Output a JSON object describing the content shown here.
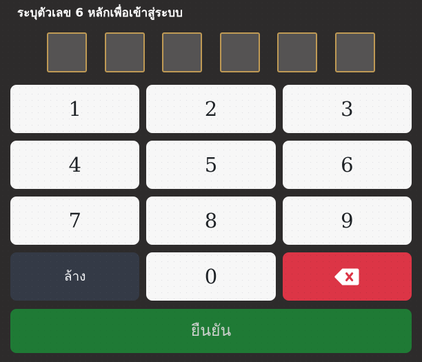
{
  "header": {
    "title": "ระบุตัวเลข 6 หลักเพื่อเข้าสู่ระบบ"
  },
  "pin": {
    "length": 6,
    "boxes": [
      "",
      "",
      "",
      "",
      "",
      ""
    ],
    "border_color": "#bf9a55",
    "fill_color": "#555353"
  },
  "keypad": {
    "keys": [
      {
        "label": "1",
        "type": "digit",
        "name": "key-1"
      },
      {
        "label": "2",
        "type": "digit",
        "name": "key-2"
      },
      {
        "label": "3",
        "type": "digit",
        "name": "key-3"
      },
      {
        "label": "4",
        "type": "digit",
        "name": "key-4"
      },
      {
        "label": "5",
        "type": "digit",
        "name": "key-5"
      },
      {
        "label": "6",
        "type": "digit",
        "name": "key-6"
      },
      {
        "label": "7",
        "type": "digit",
        "name": "key-7"
      },
      {
        "label": "8",
        "type": "digit",
        "name": "key-8"
      },
      {
        "label": "9",
        "type": "digit",
        "name": "key-9"
      },
      {
        "label": "ล้าง",
        "type": "clear",
        "name": "key-clear"
      },
      {
        "label": "0",
        "type": "digit",
        "name": "key-0"
      },
      {
        "label": "",
        "type": "backspace",
        "name": "key-backspace",
        "icon": "backspace-icon"
      }
    ],
    "clear_label": "ล้าง",
    "clear_color": "#343a46",
    "backspace_color": "#dc3546",
    "digit_color": "#f7f7f7"
  },
  "confirm": {
    "label": "ยืนยัน",
    "color": "#1f7a35"
  },
  "theme": {
    "background": "#2d2b2b",
    "accent_gold": "#bf9a55"
  }
}
